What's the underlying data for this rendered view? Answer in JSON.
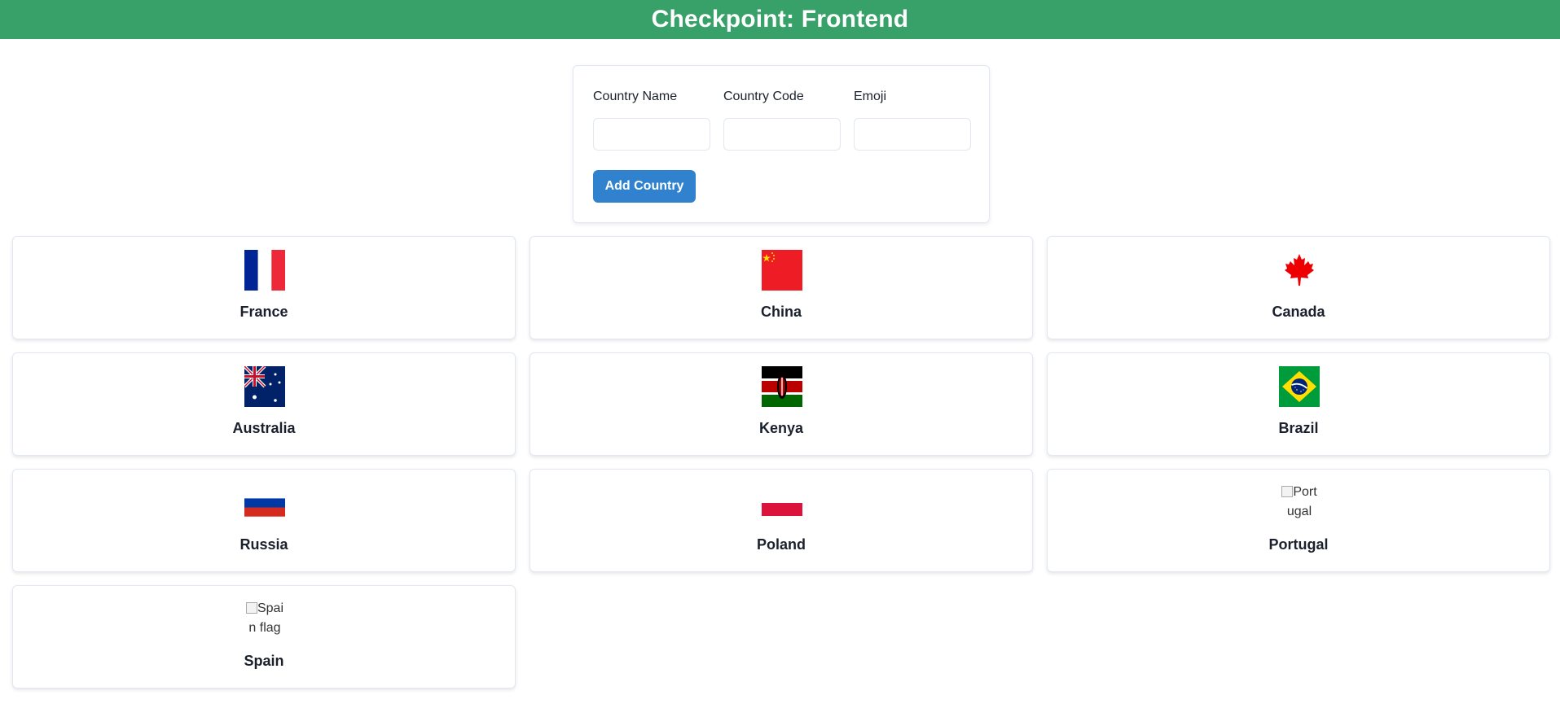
{
  "header": {
    "title": "Checkpoint: Frontend"
  },
  "form": {
    "name_label": "Country Name",
    "name_value": "",
    "code_label": "Country Code",
    "code_value": "",
    "emoji_label": "Emoji",
    "emoji_value": "",
    "submit_label": "Add Country"
  },
  "colors": {
    "header_bg": "#38a169",
    "button_bg": "#3182ce"
  },
  "countries": [
    {
      "name": "France",
      "flag": "flag-france"
    },
    {
      "name": "China",
      "flag": "flag-china"
    },
    {
      "name": "Canada",
      "flag": "flag-canada"
    },
    {
      "name": "Australia",
      "flag": "flag-australia"
    },
    {
      "name": "Kenya",
      "flag": "flag-kenya"
    },
    {
      "name": "Brazil",
      "flag": "flag-brazil"
    },
    {
      "name": "Russia",
      "flag": "flag-russia"
    },
    {
      "name": "Poland",
      "flag": "flag-poland"
    },
    {
      "name": "Portugal",
      "flag": "broken-image",
      "alt": "Portugal"
    },
    {
      "name": "Spain",
      "flag": "broken-image",
      "alt": "Spain flag"
    }
  ]
}
